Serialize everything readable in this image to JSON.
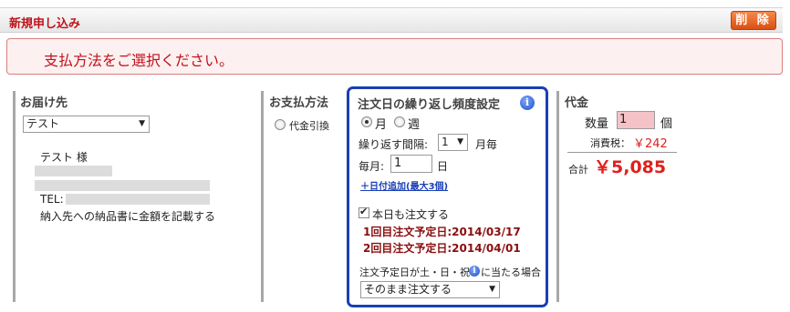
{
  "header": {
    "title": "新規申し込み",
    "delete_label": "削 除"
  },
  "alert": {
    "message": "支払方法をご選択ください。"
  },
  "delivery": {
    "title": "お届け先",
    "select_value": "テスト",
    "name": "テスト 様",
    "tel_label": "TEL:",
    "note": "納入先への納品書に金額を記載する"
  },
  "payment": {
    "title": "お支払方法",
    "option_cod": "代金引換"
  },
  "frequency": {
    "title": "注文日の繰り返し頻度設定",
    "opt_month": "月",
    "opt_week": "週",
    "interval_label": "繰り返す間隔:",
    "interval_value": "1",
    "interval_unit": "月毎",
    "monthly_label": "毎月:",
    "day_value": "1",
    "day_unit": "日",
    "add_date_link": "＋日付追加(最大3個)",
    "today_order_label": "本日も注文する",
    "schedule_1": "1回目注文予定日:2014/03/17",
    "schedule_2": "2回目注文予定日:2014/04/01",
    "holiday_note_a": "注文予定日が土・日・祝",
    "holiday_note_b": "に当たる場合",
    "holiday_select_value": "そのまま注文する"
  },
  "price": {
    "title": "代金",
    "qty_label": "数量",
    "qty_value": "1",
    "qty_unit": "個",
    "tax_label": "消費税：",
    "tax_value": "￥242",
    "total_label": "合計",
    "total_value": "￥5,085"
  },
  "colors": {
    "accent_red": "#c0121b",
    "panel_blue": "#1a3fb5",
    "button_orange": "#e8641e"
  }
}
